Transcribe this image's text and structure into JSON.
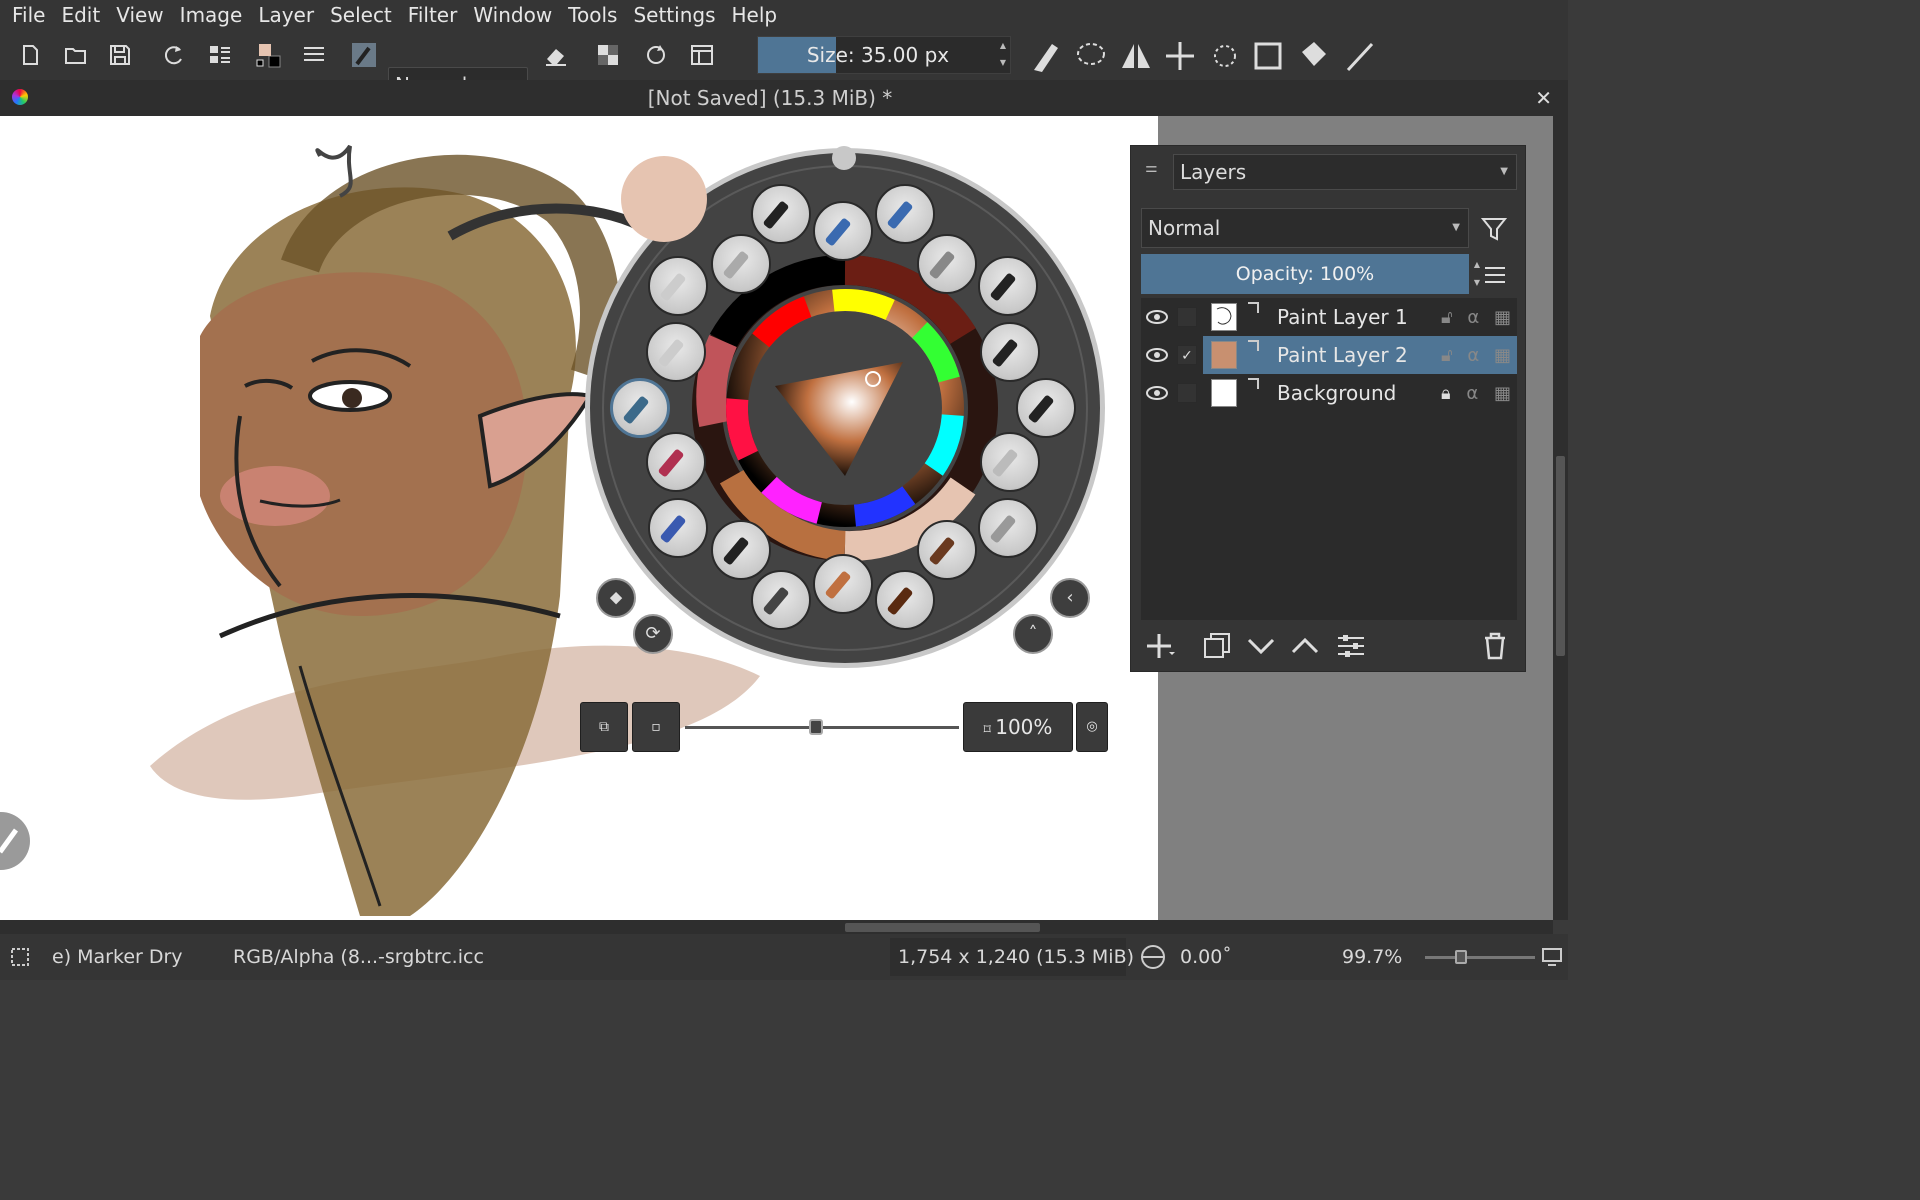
{
  "menubar": {
    "items": [
      "File",
      "Edit",
      "View",
      "Image",
      "Layer",
      "Select",
      "Filter",
      "Window",
      "Tools",
      "Settings",
      "Help"
    ]
  },
  "toolbar": {
    "blend_mode": "Normal",
    "brush_size": "Size: 35.00 px",
    "brush_size_fraction": 0.3
  },
  "document": {
    "title": "[Not Saved]  (15.3 MiB) *",
    "close": "✕"
  },
  "layers_docker": {
    "title": "Layers",
    "blend_mode": "Normal",
    "opacity": "Opacity: 100%",
    "layers": [
      {
        "name": "Paint Layer 1",
        "visible": true,
        "selected": false,
        "checked": false,
        "locked": false
      },
      {
        "name": "Paint Layer 2",
        "visible": true,
        "selected": true,
        "checked": true,
        "locked": false
      },
      {
        "name": "Background",
        "visible": true,
        "selected": false,
        "checked": false,
        "locked": true
      }
    ]
  },
  "popup_palette": {
    "zoom": "100%",
    "rotation_fraction": 0.5,
    "foreground_color": "#e6c4b1",
    "background_color": "#000000"
  },
  "statusbar": {
    "brush_preset": "e) Marker Dry",
    "color_profile": "RGB/Alpha (8...-srgbtrc.icc",
    "dimensions": "1,754 x 1,240 (15.3 MiB)",
    "rotation": "0.00˚",
    "zoom": "99.7%"
  }
}
